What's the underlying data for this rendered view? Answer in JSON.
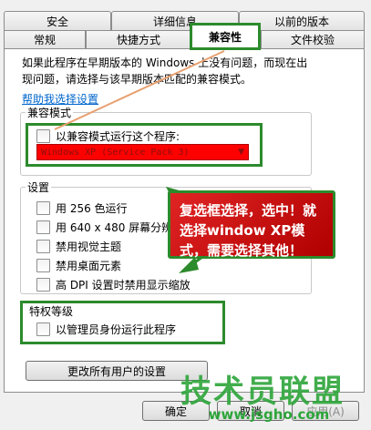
{
  "tabs": {
    "row1": [
      "安全",
      "详细信息",
      "以前的版本"
    ],
    "row2": [
      "常规",
      "快捷方式",
      "兼容性",
      "文件校验"
    ],
    "active": "兼容性"
  },
  "intro": {
    "line1": "如果此程序在早期版本的 Windows 上没有问题，而现在出",
    "line2": "现问题，请选择与该早期版本匹配的兼容模式。"
  },
  "help_link": "帮助我选择设置",
  "compat_mode": {
    "title": "兼容模式",
    "checkbox_label": "以兼容模式运行这个程序:",
    "selected_os": "Windows XP (Service Pack 3)"
  },
  "settings": {
    "title": "设置",
    "items": [
      "用 256 色运行",
      "用 640 x 480 屏幕分辨率",
      "禁用视觉主题",
      "禁用桌面元素",
      "高 DPI 设置时禁用显示缩放"
    ]
  },
  "privilege": {
    "title": "特权等级",
    "checkbox_label": "以管理员身份运行此程序"
  },
  "change_all_button": "更改所有用户的设置",
  "footer_buttons": {
    "ok": "确定",
    "cancel": "取消",
    "apply": "应用(A)"
  },
  "callout": {
    "text": "复选框选择，选中！就选择window XP模式，需要选择其他！"
  },
  "watermark": {
    "logo": "技术员联盟",
    "url": "www.jsgho.com"
  },
  "colors": {
    "highlight_red": "#ff0000",
    "annotation_green": "#2c8b2c",
    "arrow_orange": "#e8a070"
  }
}
